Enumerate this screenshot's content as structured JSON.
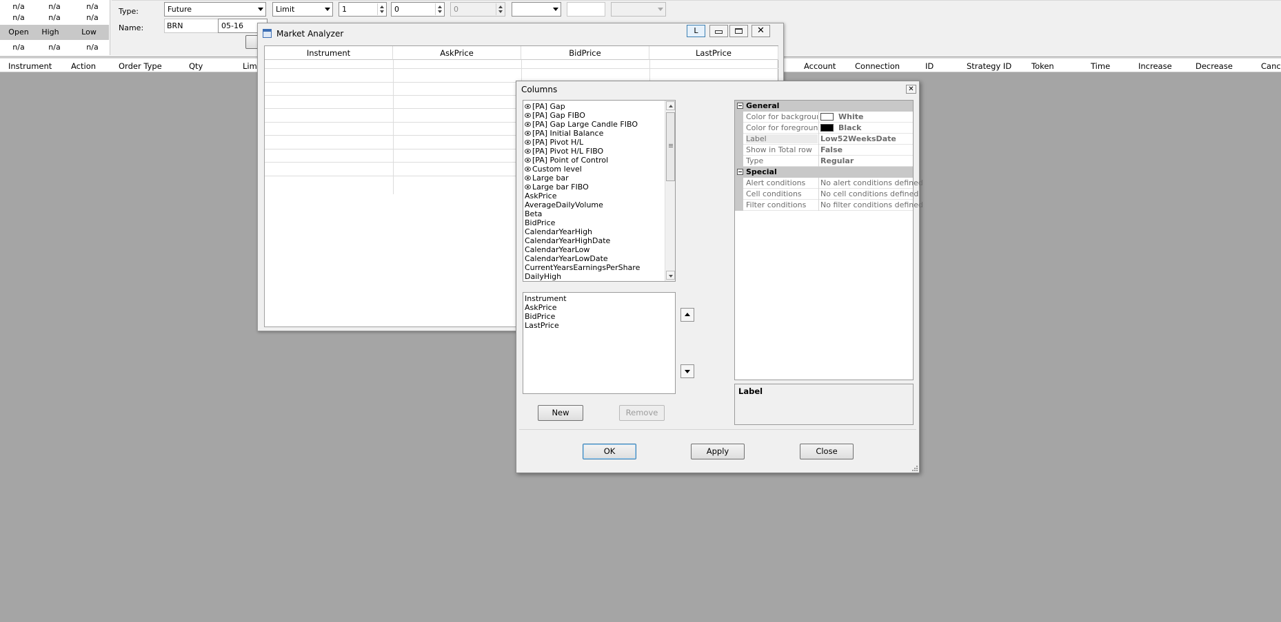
{
  "quote_panel": {
    "row1": [
      "n/a",
      "n/a",
      "n/a"
    ],
    "row2": [
      "n/a",
      "n/a",
      "n/a"
    ],
    "headers": [
      "Open",
      "High",
      "Low"
    ],
    "row3": [
      "n/a",
      "n/a",
      "n/a"
    ]
  },
  "order_panel": {
    "type_label": "Type:",
    "type_value": "Future",
    "name_label": "Name:",
    "name_value": "BRN",
    "expiry_value": "05-16",
    "order_type_value": "Limit",
    "qty_value": "1",
    "price_value": "0",
    "stop_value": "0"
  },
  "orders_header": [
    "Instrument",
    "Action",
    "Order Type",
    "Qty",
    "Lim",
    "Account",
    "Connection",
    "ID",
    "Strategy ID",
    "Token",
    "Time",
    "Increase",
    "Decrease",
    "Canc"
  ],
  "market_analyzer": {
    "title": "Market Analyzer",
    "link_button": "L",
    "columns": [
      "Instrument",
      "AskPrice",
      "BidPrice",
      "LastPrice"
    ]
  },
  "columns_dialog": {
    "title": "Columns",
    "available": [
      {
        "label": "[PA] Gap",
        "eye": true
      },
      {
        "label": "[PA] Gap FIBO",
        "eye": true
      },
      {
        "label": "[PA] Gap Large Candle FIBO",
        "eye": true
      },
      {
        "label": "[PA] Initial Balance",
        "eye": true
      },
      {
        "label": "[PA] Pivot H/L",
        "eye": true
      },
      {
        "label": "[PA] Pivot H/L FIBO",
        "eye": true
      },
      {
        "label": "[PA] Point of Control",
        "eye": true
      },
      {
        "label": "Custom level",
        "eye": true
      },
      {
        "label": "Large bar",
        "eye": true
      },
      {
        "label": "Large bar FIBO",
        "eye": true
      },
      {
        "label": "AskPrice",
        "eye": false
      },
      {
        "label": "AverageDailyVolume",
        "eye": false
      },
      {
        "label": "Beta",
        "eye": false
      },
      {
        "label": "BidPrice",
        "eye": false
      },
      {
        "label": "CalendarYearHigh",
        "eye": false
      },
      {
        "label": "CalendarYearHighDate",
        "eye": false
      },
      {
        "label": "CalendarYearLow",
        "eye": false
      },
      {
        "label": "CalendarYearLowDate",
        "eye": false
      },
      {
        "label": "CurrentYearsEarningsPerShare",
        "eye": false
      },
      {
        "label": "DailyHigh",
        "eye": false
      }
    ],
    "selected": [
      "Instrument",
      "AskPrice",
      "BidPrice",
      "LastPrice"
    ],
    "new_label": "New",
    "remove_label": "Remove",
    "ok_label": "OK",
    "apply_label": "Apply",
    "close_label": "Close",
    "properties": {
      "general_label": "General",
      "special_label": "Special",
      "general": [
        {
          "name": "Color for background",
          "value": "White",
          "swatch": "#ffffff"
        },
        {
          "name": "Color for foreground",
          "value": "Black",
          "swatch": "#000000"
        },
        {
          "name": "Label",
          "value": "Low52WeeksDate",
          "swatch": null
        },
        {
          "name": "Show in Total row",
          "value": "False",
          "swatch": null
        },
        {
          "name": "Type",
          "value": "Regular",
          "swatch": null
        }
      ],
      "special": [
        {
          "name": "Alert conditions",
          "value": "No alert conditions defined"
        },
        {
          "name": "Cell conditions",
          "value": "No cell conditions defined"
        },
        {
          "name": "Filter conditions",
          "value": "No filter conditions defined"
        }
      ]
    },
    "description_title": "Label"
  }
}
